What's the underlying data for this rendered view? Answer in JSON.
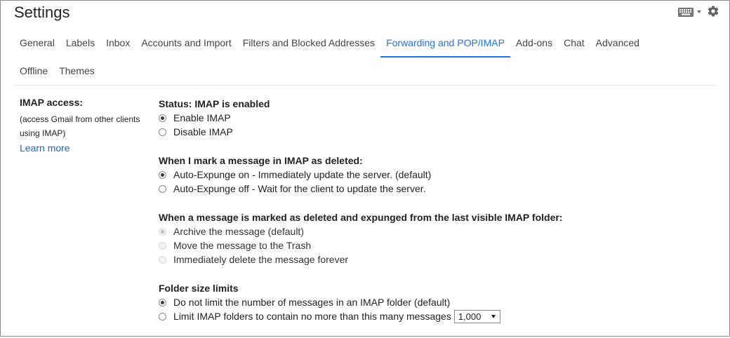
{
  "header": {
    "title": "Settings"
  },
  "tabs": [
    {
      "label": "General"
    },
    {
      "label": "Labels"
    },
    {
      "label": "Inbox"
    },
    {
      "label": "Accounts and Import"
    },
    {
      "label": "Filters and Blocked Addresses"
    },
    {
      "label": "Forwarding and POP/IMAP",
      "active": true
    },
    {
      "label": "Add-ons"
    },
    {
      "label": "Chat"
    },
    {
      "label": "Advanced"
    },
    {
      "label": "Offline"
    },
    {
      "label": "Themes"
    }
  ],
  "imap": {
    "label": "IMAP access:",
    "desc_line1": "(access Gmail from other clients",
    "desc_line2": "using IMAP)",
    "learn_more": "Learn more",
    "status": "Status: IMAP is enabled",
    "enable": "Enable IMAP",
    "disable": "Disable IMAP",
    "deleted_title": "When I mark a message in IMAP as deleted:",
    "expunge_on": "Auto-Expunge on - Immediately update the server. (default)",
    "expunge_off": "Auto-Expunge off - Wait for the client to update the server.",
    "expunged_title": "When a message is marked as deleted and expunged from the last visible IMAP folder:",
    "archive": "Archive the message (default)",
    "trash": "Move the message to the Trash",
    "delete_forever": "Immediately delete the message forever",
    "folder_title": "Folder size limits",
    "no_limit": "Do not limit the number of messages in an IMAP folder (default)",
    "limit": "Limit IMAP folders to contain no more than this many messages",
    "limit_value": "1,000"
  },
  "colors": {
    "accent": "#1a73e8",
    "link": "#1a66c9"
  },
  "icons": [
    "keyboard-icon",
    "dropdown-caret-icon",
    "settings-gear-icon"
  ]
}
